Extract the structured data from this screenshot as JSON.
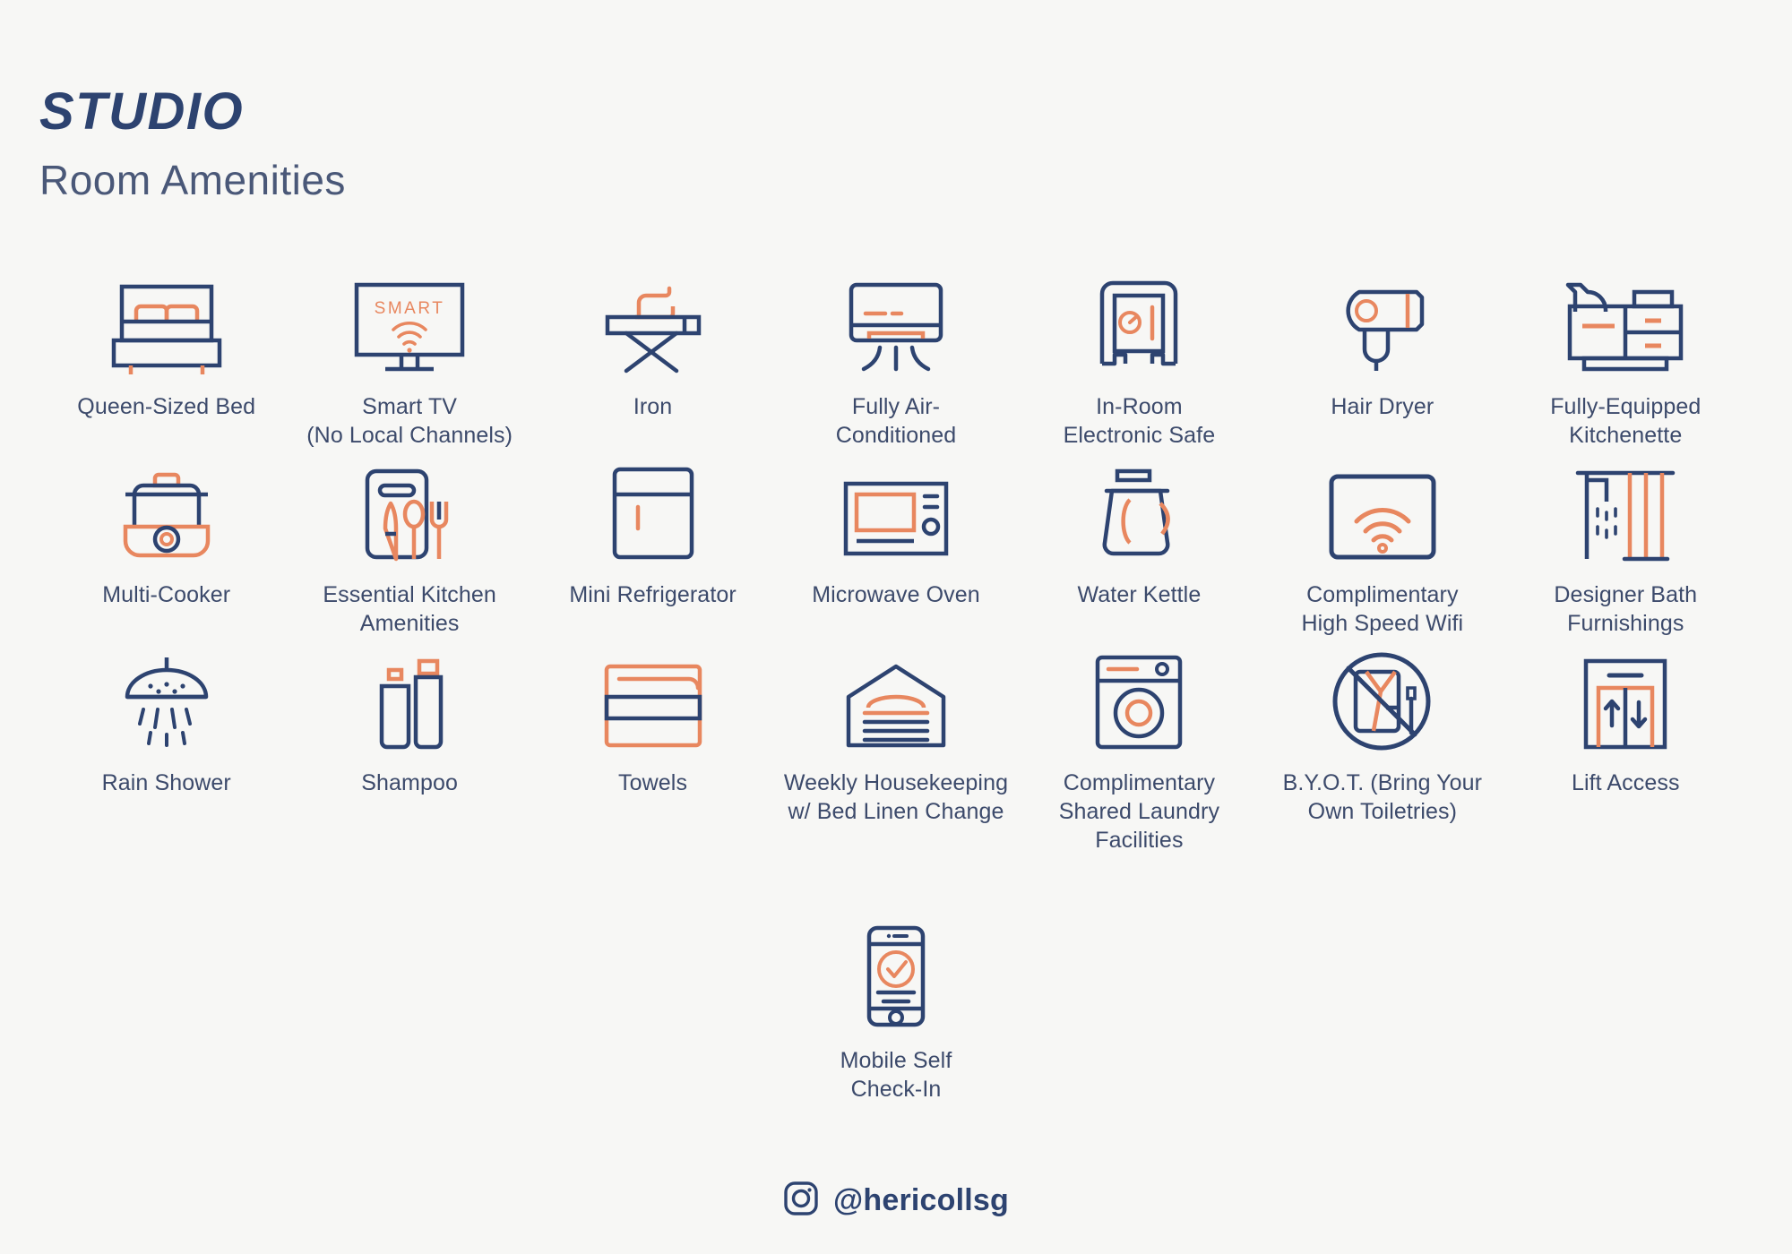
{
  "header": {
    "title": "STUDIO",
    "subtitle": "Room Amenities"
  },
  "colors": {
    "background": "#f7f7f5",
    "navy": "#2d4370",
    "coral": "#e8875f",
    "text": "#3c4a6b"
  },
  "footer": {
    "handle": "@hericollsg",
    "icon": "instagram-icon"
  },
  "amenities": [
    {
      "icon": "bed-icon",
      "label": "Queen-Sized Bed"
    },
    {
      "icon": "smart-tv-icon",
      "label": "Smart TV\n(No Local Channels)",
      "line1": "Smart TV",
      "line2": "(No Local Channels)",
      "screen_text": "SMART"
    },
    {
      "icon": "iron-icon",
      "label": "Iron"
    },
    {
      "icon": "air-conditioner-icon",
      "label": "Fully Air-\nConditioned",
      "line1": "Fully Air-",
      "line2": "Conditioned"
    },
    {
      "icon": "safe-icon",
      "label": "In-Room\nElectronic Safe",
      "line1": "In-Room",
      "line2": "Electronic Safe"
    },
    {
      "icon": "hair-dryer-icon",
      "label": "Hair Dryer"
    },
    {
      "icon": "kitchenette-icon",
      "label": "Fully-Equipped\nKitchenette",
      "line1": "Fully-Equipped",
      "line2": "Kitchenette"
    },
    {
      "icon": "multi-cooker-icon",
      "label": "Multi-Cooker"
    },
    {
      "icon": "cutlery-board-icon",
      "label": "Essential Kitchen\nAmenities",
      "line1": "Essential Kitchen",
      "line2": "Amenities"
    },
    {
      "icon": "refrigerator-icon",
      "label": "Mini Refrigerator"
    },
    {
      "icon": "microwave-icon",
      "label": "Microwave Oven"
    },
    {
      "icon": "kettle-icon",
      "label": "Water Kettle"
    },
    {
      "icon": "wifi-icon",
      "label": "Complimentary\nHigh Speed Wifi",
      "line1": "Complimentary",
      "line2": "High Speed Wifi"
    },
    {
      "icon": "shower-curtain-icon",
      "label": "Designer Bath\nFurnishings",
      "line1": "Designer Bath",
      "line2": "Furnishings"
    },
    {
      "icon": "rain-shower-icon",
      "label": "Rain Shower"
    },
    {
      "icon": "shampoo-icon",
      "label": "Shampoo"
    },
    {
      "icon": "towels-icon",
      "label": "Towels"
    },
    {
      "icon": "housekeeping-icon",
      "label": "Weekly Housekeeping\nw/ Bed Linen Change",
      "line1": "Weekly Housekeeping",
      "line2": "w/ Bed Linen Change"
    },
    {
      "icon": "laundry-icon",
      "label": "Complimentary\nShared Laundry\nFacilities",
      "line1": "Complimentary",
      "line2": "Shared Laundry",
      "line3": "Facilities"
    },
    {
      "icon": "no-toiletries-icon",
      "label": "B.Y.O.T. (Bring Your\nOwn Toiletries)",
      "line1": "B.Y.O.T. (Bring Your",
      "line2": "Own Toiletries)"
    },
    {
      "icon": "lift-icon",
      "label": "Lift Access"
    },
    {
      "icon": "mobile-checkin-icon",
      "label": "Mobile Self\nCheck-In",
      "line1": "Mobile Self",
      "line2": "Check-In"
    }
  ]
}
